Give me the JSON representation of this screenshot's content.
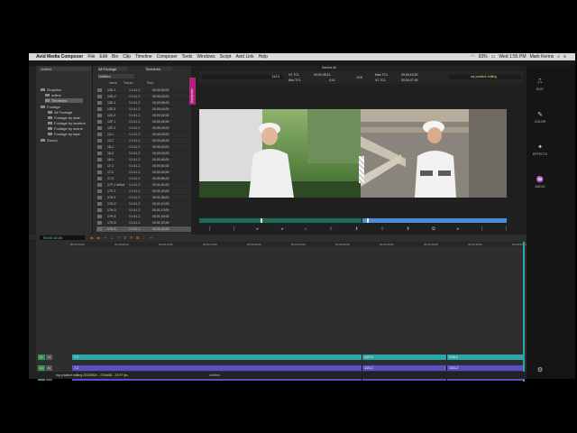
{
  "menubar": {
    "app_name": "Avid Media Composer",
    "items": [
      "File",
      "Edit",
      "Bin",
      "Clip",
      "Timeline",
      "Composer",
      "Tools",
      "Windows",
      "Script",
      "Avid Link",
      "Help"
    ],
    "battery": "93%",
    "datetime": "Wed 1:55 PM",
    "user": "Mark Kerins"
  },
  "bins": {
    "header": "Untitled",
    "items": [
      "Graphics",
      "online",
      "Timelines",
      "Footage",
      "All Footage",
      "Footage by date",
      "Footage by location",
      "Footage by scene",
      "Footage by tape",
      "Sound"
    ]
  },
  "cliplist": {
    "tab1": "All Footage",
    "tab2": "Timelines",
    "subtab": "Untitled",
    "columns": [
      "Name",
      "Tracks",
      "Start"
    ],
    "rows": [
      {
        "name": "12D-1",
        "tracks": "V1 A1-2",
        "start": "00;00;00;00"
      },
      {
        "name": "12D-2",
        "tracks": "V1 A1-2",
        "start": "00;00;03;00"
      },
      {
        "name": "12E-1",
        "tracks": "V1 A1-2",
        "start": "00;00;06;00"
      },
      {
        "name": "12E-3",
        "tracks": "V1 A1-2",
        "start": "00;00;16;00"
      },
      {
        "name": "12Z-2",
        "tracks": "V1 A1-2",
        "start": "00;00;22;00"
      },
      {
        "name": "12F-1",
        "tracks": "V1 A1-2",
        "start": "00;00;26;00"
      },
      {
        "name": "12F-2",
        "tracks": "V1 A1-2",
        "start": "00;00;29;00"
      },
      {
        "name": "13-1",
        "tracks": "V1 A1-2",
        "start": "00;00;33;00"
      },
      {
        "name": "13-2",
        "tracks": "V1 A1-2",
        "start": "00;00;36;00"
      },
      {
        "name": "15-1",
        "tracks": "V1 A1-2",
        "start": "00;00;40;00"
      },
      {
        "name": "15-2",
        "tracks": "V1 A1-2",
        "start": "00;00;43;00"
      },
      {
        "name": "16-1",
        "tracks": "V1 A1-2",
        "start": "00;00;46;00"
      },
      {
        "name": "17-1",
        "tracks": "V1 A1-2",
        "start": "00;00;50;00"
      },
      {
        "name": "17-2",
        "tracks": "V1 A1-2",
        "start": "00;00;53;00"
      },
      {
        "name": "17-3",
        "tracks": "V1 A1-2",
        "start": "00;00;56;00"
      },
      {
        "name": "17F-1 refind",
        "tracks": "V1 A1-2",
        "start": "00;01;00;00"
      },
      {
        "name": "17F-2",
        "tracks": "V1 A1-2",
        "start": "00;01;03;00"
      },
      {
        "name": "17H-1",
        "tracks": "V1 A1-2",
        "start": "00;01;06;00"
      },
      {
        "name": "17H-2",
        "tracks": "V1 A1-2",
        "start": "00;01;10;00"
      },
      {
        "name": "17H-3",
        "tracks": "V1 A1-2",
        "start": "00;01;13;00"
      },
      {
        "name": "17H-4",
        "tracks": "V1 A1-2",
        "start": "00;01;16;00"
      },
      {
        "name": "17H-5",
        "tracks": "V1 A1-2",
        "start": "00;01;20;00"
      },
      {
        "name": "17H-6",
        "tracks": "V1 A1-2",
        "start": "00;01;23;00"
      }
    ]
  },
  "composer": {
    "tab_label": "Composer",
    "title": "Sandra 40",
    "source_tc_label1": "V1 TC1",
    "source_tc_value1": "00;00;28;12",
    "source_tc_label2": "Abs TC1",
    "source_tc_value2": "4;11",
    "source_clip": "112;3",
    "record_tc_label1": "Mas TC1",
    "record_tc_value1": "00;00;15;20",
    "record_tc_label2": "V1 TC1",
    "record_tc_value2": "00;04;47;18",
    "record_seq": "my practice editing",
    "fraction": "1/16"
  },
  "rpanel": {
    "buttons": [
      "EDIT",
      "COLOR",
      "EFFECTS",
      "AUDIO"
    ]
  },
  "timeline": {
    "timecode": "00;00;10;20",
    "tracks": [
      {
        "label": "V1",
        "clips": [
          "7-2",
          "1/22-1",
          "1/16-2"
        ]
      },
      {
        "label": "A1",
        "clips": [
          "7-2",
          "1/22-1",
          "1/16-2"
        ]
      },
      {
        "label": "A2",
        "clips": [
          "7-2",
          "1/22-1",
          "1/16-2"
        ]
      }
    ],
    "ticks": [
      "00;00;00;00",
      "00;00;05;00",
      "00;00;10;00",
      "00;00;15;00",
      "00;00;20;00",
      "00;00;25;00",
      "00;00;30;00",
      "00;00;35;00",
      "00;00;40;00",
      "00;00;45;00",
      "00;00;50;00"
    ],
    "status_text": "my practice editing 20200824 - 720x486 - 29.97 fps",
    "untitled": "Untitled"
  },
  "colors": {
    "video_track": "#2aa6a7",
    "audio_track": "#5a4fc7",
    "composer_accent": "#b3207e",
    "blue_bar": "#4a8fd6",
    "green_bar": "#1f6b5a"
  }
}
